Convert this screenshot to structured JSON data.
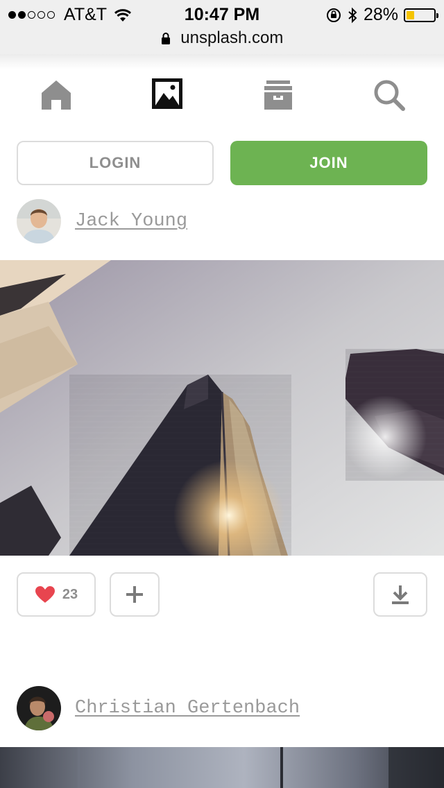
{
  "status_bar": {
    "carrier": "AT&T",
    "time": "10:47 PM",
    "battery_percent": "28%",
    "battery_level": 0.28,
    "signal_bars_filled": 2,
    "signal_bars_total": 5
  },
  "browser": {
    "url": "unsplash.com"
  },
  "nav": {
    "icons": [
      "home-icon",
      "photos-icon",
      "collections-icon",
      "search-icon"
    ]
  },
  "auth": {
    "login_label": "LOGIN",
    "join_label": "JOIN"
  },
  "posts": [
    {
      "author": "Jack Young",
      "likes": "23"
    },
    {
      "author": "Christian Gertenbach"
    }
  ],
  "colors": {
    "join": "#6db352",
    "heart": "#e8454f",
    "muted": "#8e8e8e"
  }
}
